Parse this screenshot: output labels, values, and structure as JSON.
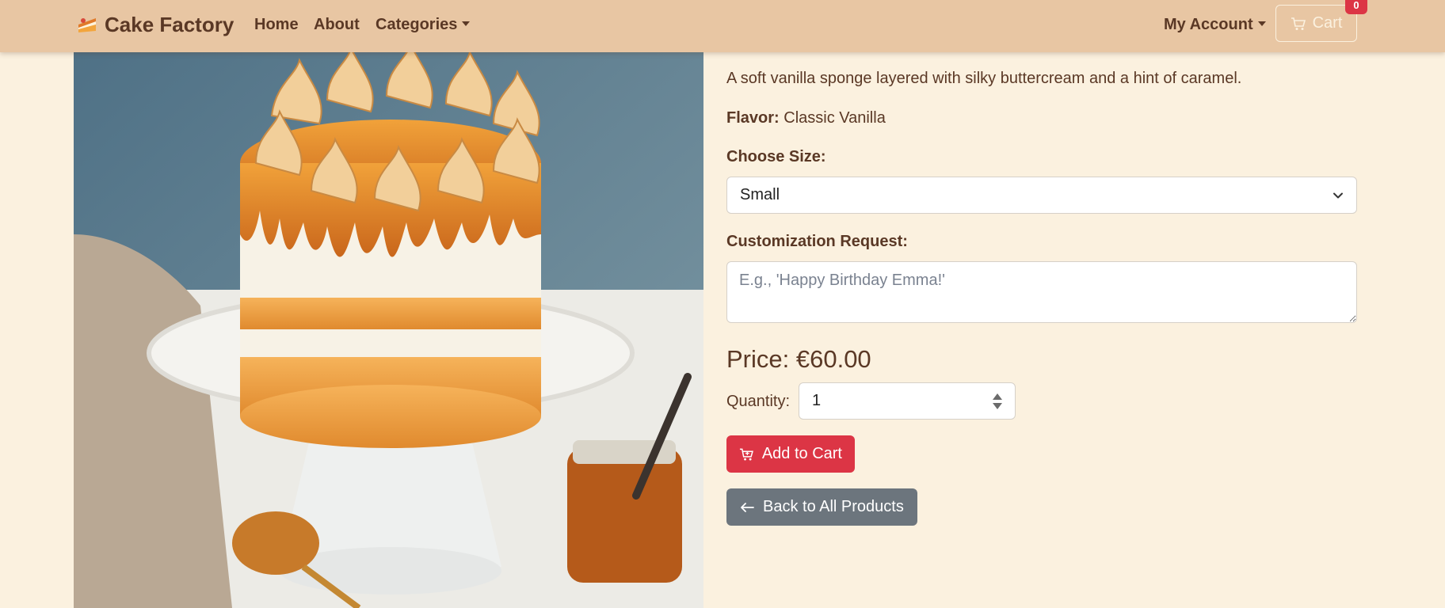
{
  "navbar": {
    "brand": "Cake Factory",
    "links": [
      "Home",
      "About",
      "Categories"
    ],
    "account": "My Account",
    "cart_label": "Cart",
    "cart_count": "0"
  },
  "product": {
    "description": "A soft vanilla sponge layered with silky buttercream and a hint of caramel.",
    "flavor_label": "Flavor:",
    "flavor_value": "Classic Vanilla",
    "size_label": "Choose Size:",
    "size_selected": "Small",
    "custom_label": "Customization Request:",
    "custom_placeholder": "E.g., 'Happy Birthday Emma!'",
    "price": "Price: €60.00",
    "quantity_label": "Quantity:",
    "quantity_value": "1",
    "add_to_cart": "Add to Cart",
    "back": "Back to All Products"
  },
  "colors": {
    "navbar_bg": "#e8c6a3",
    "page_bg": "#fbf1df",
    "text": "#5a3825",
    "danger": "#dc3545",
    "secondary": "#6c757d"
  },
  "icons": [
    "cake-slice-icon",
    "cart-icon",
    "chevron-down-icon",
    "arrow-left-icon"
  ]
}
